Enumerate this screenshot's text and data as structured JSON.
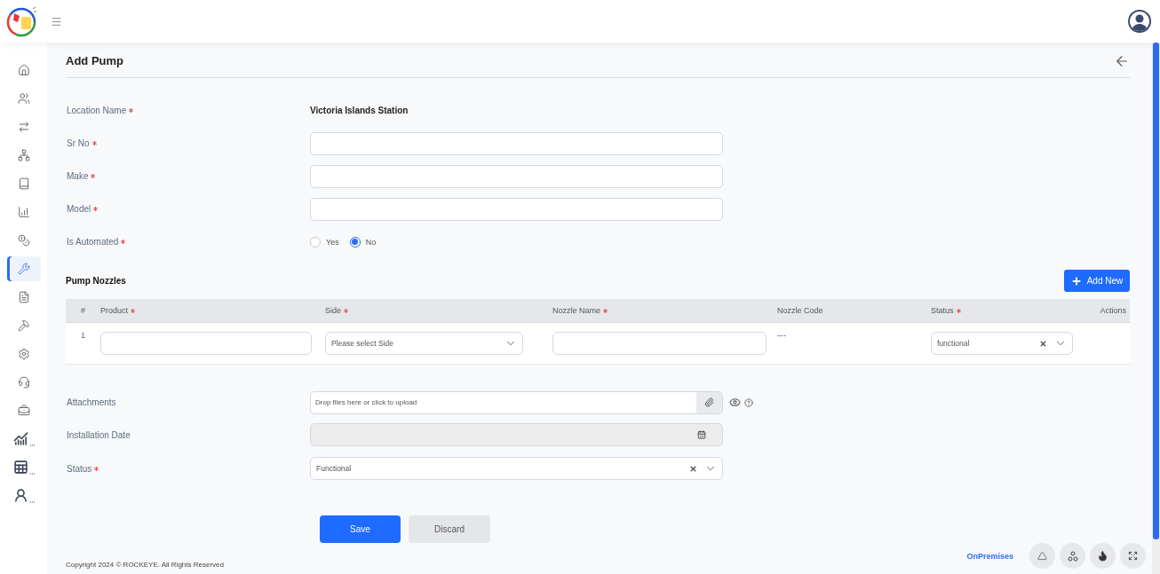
{
  "sidebar": {
    "items": [
      {
        "selected": false
      },
      {
        "selected": false
      },
      {
        "selected": false
      },
      {
        "selected": false
      },
      {
        "selected": false
      },
      {
        "selected": false
      },
      {
        "selected": false
      },
      {
        "selected": true
      },
      {
        "selected": false
      },
      {
        "selected": false
      },
      {
        "selected": false
      },
      {
        "selected": false
      },
      {
        "selected": false
      },
      {
        "selected": false
      },
      {
        "selected": false
      },
      {
        "selected": false
      }
    ]
  },
  "page": {
    "title": "Add Pump"
  },
  "form": {
    "fields": [
      {
        "kind": "static",
        "label": "Location Name",
        "required": true,
        "value": "Victoria Islands Station"
      },
      {
        "kind": "input",
        "label": "Sr No",
        "required": true
      },
      {
        "kind": "input",
        "label": "Make",
        "required": true
      },
      {
        "kind": "input",
        "label": "Model",
        "required": true
      },
      {
        "kind": "radio",
        "label": "Is Automated",
        "required": true,
        "options": [
          {
            "label": "Yes",
            "selected": false
          },
          {
            "label": "No",
            "selected": true
          }
        ]
      }
    ]
  },
  "nozzles": {
    "title": "Pump Nozzles",
    "add_button": "Add New",
    "columns": [
      {
        "label": "#",
        "required": false
      },
      {
        "label": "Product",
        "required": true
      },
      {
        "label": "Side",
        "required": true
      },
      {
        "label": "Nozzle Name",
        "required": true
      },
      {
        "label": "Nozzle Code",
        "required": false
      },
      {
        "label": "Status",
        "required": true
      },
      {
        "label": "Actions",
        "required": false
      }
    ],
    "rows": [
      {
        "index": "1",
        "side_placeholder": "Please select Side",
        "nozzle_code": "---",
        "status": "functional"
      }
    ]
  },
  "details": {
    "fields": [
      {
        "kind": "upload",
        "label": "Attachments",
        "required": false,
        "placeholder": "Drop files here or click to upload"
      },
      {
        "kind": "date",
        "label": "Installation Date",
        "required": false,
        "disabled": true
      },
      {
        "kind": "select",
        "label": "Status",
        "required": true,
        "value": "Functional"
      }
    ]
  },
  "buttons": {
    "save": "Save",
    "discard": "Discard"
  },
  "footer": {
    "copyright": "Copyright 2024 © ROCKEYE. All Rights Reserved",
    "mode": "OnPremises"
  }
}
